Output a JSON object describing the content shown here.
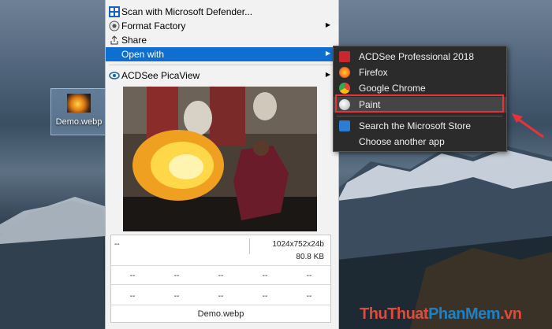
{
  "desktop": {
    "file_icon_label": "Demo.webp"
  },
  "context_menu": {
    "items": [
      {
        "label": "Scan with Microsoft Defender...",
        "icon": "defender-icon",
        "has_submenu": false
      },
      {
        "label": "Format Factory",
        "icon": "format-factory-icon",
        "has_submenu": true
      },
      {
        "label": "Share",
        "icon": "share-icon",
        "has_submenu": false
      },
      {
        "label": "Open with",
        "icon": "",
        "has_submenu": true,
        "selected": true
      },
      {
        "label": "ACDSee PicaView",
        "icon": "acdsee-picaview-icon",
        "has_submenu": true
      }
    ]
  },
  "picaview": {
    "dash": "--",
    "dimensions": "1024x752x24b",
    "file_size": "80.8 KB",
    "grid_cells": [
      "--",
      "--",
      "--",
      "--",
      "--",
      "--",
      "--",
      "--",
      "--",
      "--"
    ],
    "filename": "Demo.webp"
  },
  "open_with_submenu": {
    "items": [
      {
        "label": "ACDSee Professional 2018",
        "icon": "acdsee-pro-icon",
        "color": "#c8282d"
      },
      {
        "label": "Firefox",
        "icon": "firefox-icon",
        "color": "#ff7a1a"
      },
      {
        "label": "Google Chrome",
        "icon": "chrome-icon",
        "color": "#34a853"
      },
      {
        "label": "Paint",
        "icon": "paint-icon",
        "color": "#d9d9d9",
        "highlighted": true
      },
      {
        "label": "Search the Microsoft Store",
        "icon": "store-icon",
        "color": "#2b7cd3"
      },
      {
        "label": "Choose another app",
        "icon": "",
        "color": ""
      }
    ]
  },
  "watermark": {
    "part1": "ThuThuat",
    "part2": "PhanMem",
    "part3": ".vn"
  }
}
